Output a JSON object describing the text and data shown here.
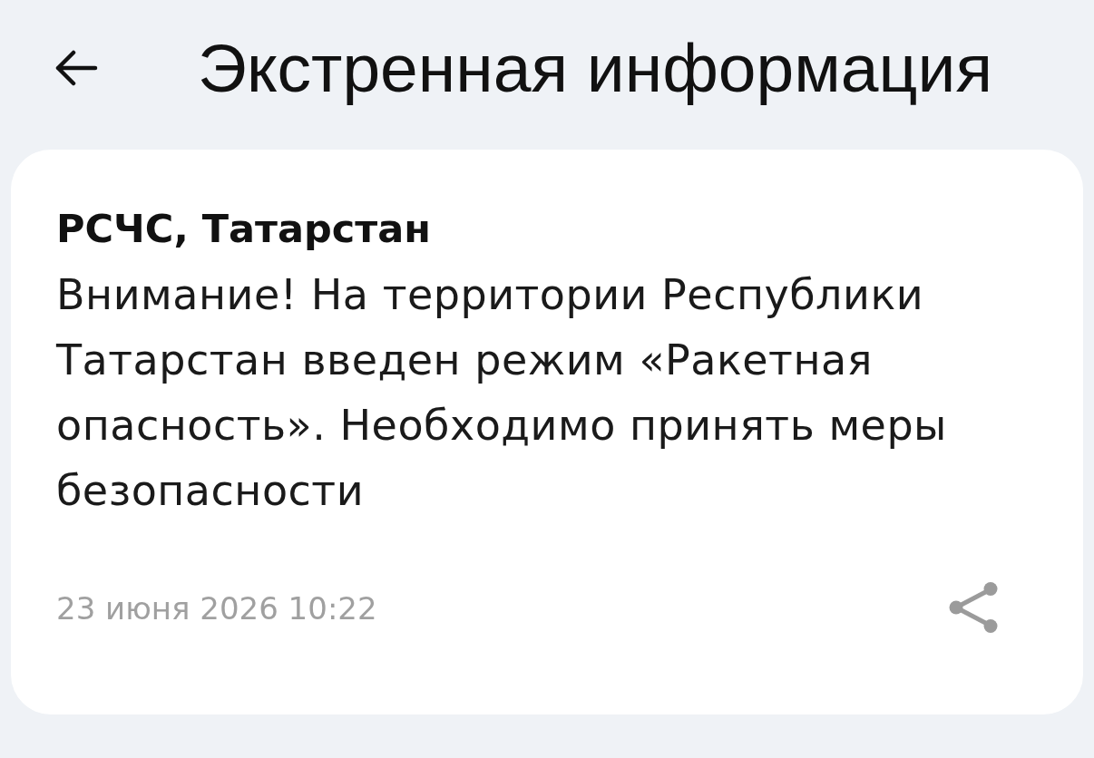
{
  "header": {
    "title": "Экстренная информация"
  },
  "alert": {
    "source": "РСЧС, Татарстан",
    "message": "Внимание! На территории Республики Татарстан введен режим «Ракетная опасность». Необходимо принять меры безопасности",
    "timestamp": "23 июня 2026 10:22"
  }
}
